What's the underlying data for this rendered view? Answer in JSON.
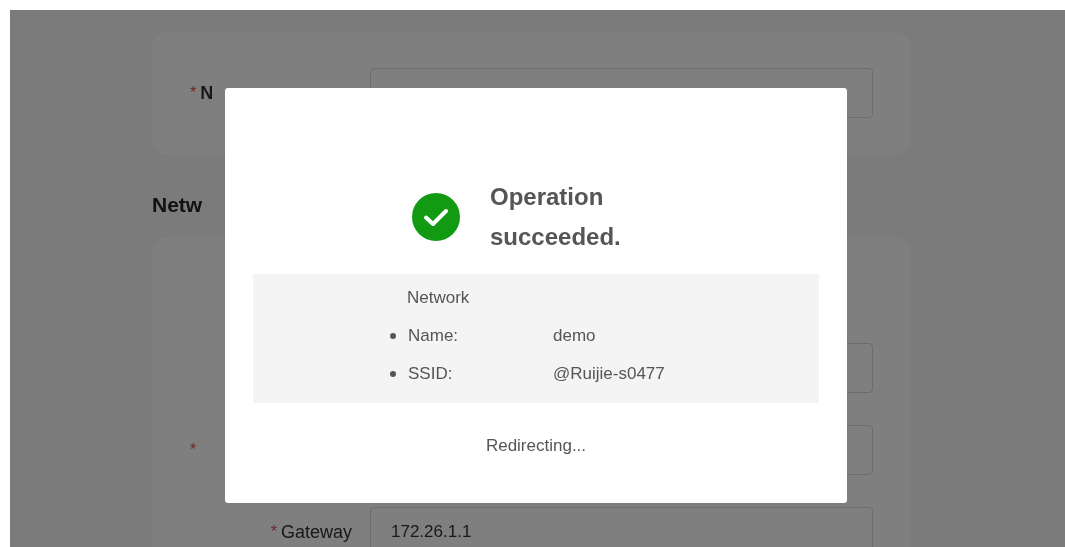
{
  "page": {
    "top_card": {
      "fields": [
        {
          "kind": "covered",
          "required_mark": "*",
          "label": "N"
        }
      ]
    },
    "section_heading": "Netw",
    "section_card": {
      "fields": [
        {
          "kind": "covered"
        },
        {
          "kind": "covered",
          "required_mark": "*"
        },
        {
          "kind": "full",
          "required_mark": "*",
          "label": "Gateway",
          "value": "172.26.1.1"
        }
      ]
    }
  },
  "dialog": {
    "title": "Operation succeeded.",
    "details": {
      "heading": "Network",
      "items": [
        {
          "label": "Name:",
          "value": "demo"
        },
        {
          "label": "SSID:",
          "value": "@Ruijie-s0477"
        }
      ]
    },
    "footer": "Redirecting..."
  }
}
